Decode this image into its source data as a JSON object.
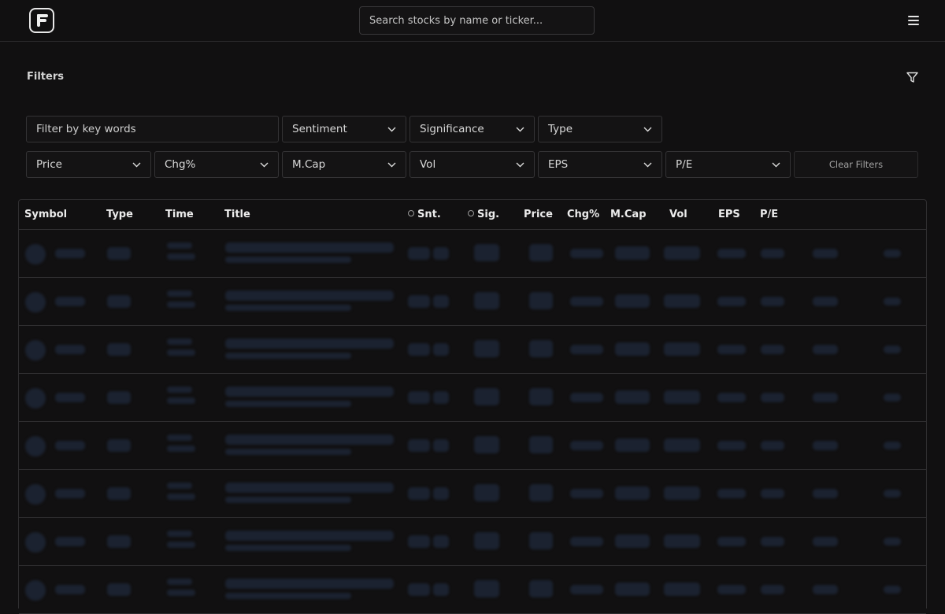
{
  "header": {
    "logo_icon": "f-logo-icon",
    "search_placeholder": "Search stocks by name or ticker...",
    "menu_icon": "hamburger-menu-icon"
  },
  "filters": {
    "title": "Filters",
    "filter_icon": "funnel-icon",
    "keyword_placeholder": "Filter by key words",
    "row1": [
      "Sentiment",
      "Significance",
      "Type"
    ],
    "row2": [
      "Price",
      "Chg%",
      "M.Cap",
      "Vol",
      "EPS",
      "P/E"
    ],
    "clear_label": "Clear Filters"
  },
  "table": {
    "columns": [
      "Symbol",
      "Type",
      "Time",
      "Title",
      "Snt.",
      "Sig.",
      "Price",
      "Chg%",
      "M.Cap",
      "Vol",
      "EPS",
      "P/E"
    ],
    "loading_rows": 8
  },
  "colors": {
    "background": "#111011",
    "border": "#2f2e30",
    "skeleton": "#1b2230"
  }
}
